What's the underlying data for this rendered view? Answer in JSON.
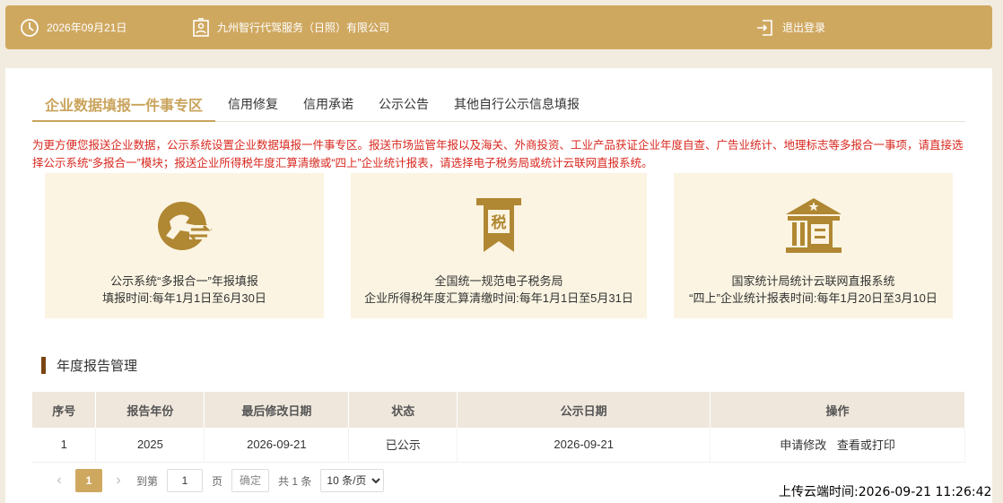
{
  "header": {
    "date": "2026年09月21日",
    "company": "九州智行代驾服务（日照）有限公司",
    "logout": "退出登录",
    "background_color": "#cfa860"
  },
  "tabs": [
    {
      "label": "企业数据填报一件事专区",
      "active": true
    },
    {
      "label": "信用修复",
      "active": false
    },
    {
      "label": "信用承诺",
      "active": false
    },
    {
      "label": "公示公告",
      "active": false
    },
    {
      "label": "其他自行公示信息填报",
      "active": false
    }
  ],
  "notice": "为更方便您报送企业数据，公示系统设置企业数据填报一件事专区。报送市场监管年报以及海关、外商投资、工业产品获证企业年度自查、广告业统计、地理标志等多报合一事项，请直接选择公示系统“多报合一”模块；报送企业所得税年度汇算清缴或“四上”企业统计报表，请选择电子税务局或统计云联网直报系统。",
  "cards": [
    {
      "icon": "multi-report-icon",
      "title": "公示系统“多报合一”年报填报",
      "subtitle": "填报时间:每年1月1日至6月30日"
    },
    {
      "icon": "tax-icon",
      "icon_text": "税",
      "title": "全国统一规范电子税务局",
      "subtitle": "企业所得税年度汇算清缴时间:每年1月1日至5月31日"
    },
    {
      "icon": "statistics-bureau-icon",
      "title": "国家统计局统计云联网直报系统",
      "subtitle": "“四上”企业统计报表时间:每年1月20日至3月10日"
    }
  ],
  "section": {
    "title": "年度报告管理"
  },
  "table": {
    "headers": [
      "序号",
      "报告年份",
      "最后修改日期",
      "状态",
      "公示日期",
      "操作"
    ],
    "rows": [
      {
        "index": "1",
        "year": "2025",
        "modified": "2026-09-21",
        "status": "已公示",
        "published": "2026-09-21",
        "op_edit": "申请修改",
        "op_view": "查看或打印"
      }
    ]
  },
  "pager": {
    "current_page": "1",
    "goto_label": "到第",
    "goto_value": "1",
    "page_label": "页",
    "confirm": "确定",
    "total": "共 1 条",
    "page_size": "10 条/页"
  },
  "upload_time": "上传云端时间:2026-09-21 11:26:42",
  "colors": {
    "accent": "#cfa860",
    "notice": "#d8281f",
    "card_bg": "#fbf4e2",
    "icon": "#b08732"
  }
}
